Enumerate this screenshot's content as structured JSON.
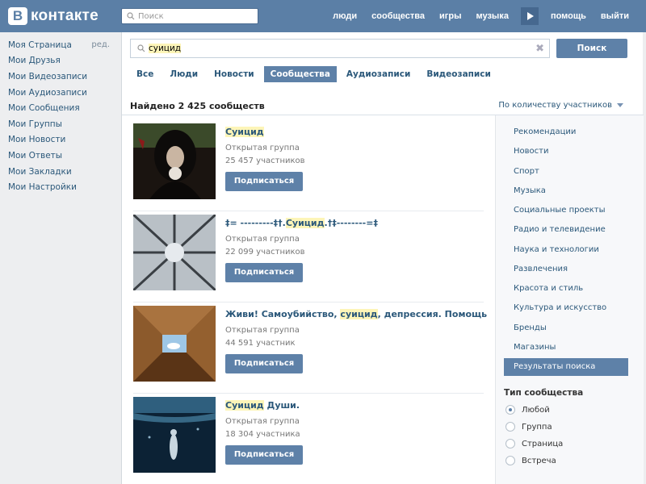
{
  "header": {
    "logo_letter": "B",
    "logo_text": "контакте",
    "search_placeholder": "Поиск",
    "nav": [
      "люди",
      "сообщества",
      "игры",
      "музыка",
      "помощь",
      "выйти"
    ]
  },
  "sidebar": {
    "edit_label": "ред.",
    "items": [
      "Моя Страница",
      "Мои Друзья",
      "Мои Видеозаписи",
      "Мои Аудиозаписи",
      "Мои Сообщения",
      "Мои Группы",
      "Мои Новости",
      "Мои Ответы",
      "Мои Закладки",
      "Мои Настройки"
    ]
  },
  "search": {
    "query": "суицид",
    "button_label": "Поиск",
    "clear_symbol": "✖"
  },
  "tabs": [
    {
      "label": "Все",
      "active": false
    },
    {
      "label": "Люди",
      "active": false
    },
    {
      "label": "Новости",
      "active": false
    },
    {
      "label": "Сообщества",
      "active": true
    },
    {
      "label": "Аудиозаписи",
      "active": false
    },
    {
      "label": "Видеозаписи",
      "active": false
    }
  ],
  "found_text": "Найдено 2 425 сообществ",
  "sort_label": "По количеству участников",
  "results": [
    {
      "name_pre": "",
      "name_hl": "Суицид",
      "name_post": "",
      "type": "Открытая группа",
      "members": "25 457 участников",
      "button": "Подписаться"
    },
    {
      "name_pre": "‡= ---------‡†.",
      "name_hl": "Суицид",
      "name_post": ".†‡--------=‡",
      "type": "Открытая группа",
      "members": "22 099 участников",
      "button": "Подписаться"
    },
    {
      "name_pre": "Живи! Самоубийство, ",
      "name_hl": "суицид",
      "name_post": ", депрессия. Помощь",
      "type": "Открытая группа",
      "members": "44 591 участник",
      "button": "Подписаться"
    },
    {
      "name_pre": "",
      "name_hl": "Суицид",
      "name_post": " Души.",
      "type": "Открытая группа",
      "members": "18 304 участника",
      "button": "Подписаться"
    }
  ],
  "categories": [
    {
      "label": "Рекомендации",
      "active": false
    },
    {
      "label": "Новости",
      "active": false
    },
    {
      "label": "Спорт",
      "active": false
    },
    {
      "label": "Музыка",
      "active": false
    },
    {
      "label": "Социальные проекты",
      "active": false
    },
    {
      "label": "Радио и телевидение",
      "active": false
    },
    {
      "label": "Наука и технологии",
      "active": false
    },
    {
      "label": "Развлечения",
      "active": false
    },
    {
      "label": "Красота и стиль",
      "active": false
    },
    {
      "label": "Культура и искусство",
      "active": false
    },
    {
      "label": "Бренды",
      "active": false
    },
    {
      "label": "Магазины",
      "active": false
    },
    {
      "label": "Результаты поиска",
      "active": true
    }
  ],
  "community_type": {
    "title": "Тип сообщества",
    "options": [
      {
        "label": "Любой",
        "checked": true
      },
      {
        "label": "Группа",
        "checked": false
      },
      {
        "label": "Страница",
        "checked": false
      },
      {
        "label": "Встреча",
        "checked": false
      }
    ]
  },
  "colors": {
    "header": "#5b7fa6",
    "accent": "#5e81a8",
    "link": "#2b587a",
    "highlight": "#fdf5b8"
  }
}
